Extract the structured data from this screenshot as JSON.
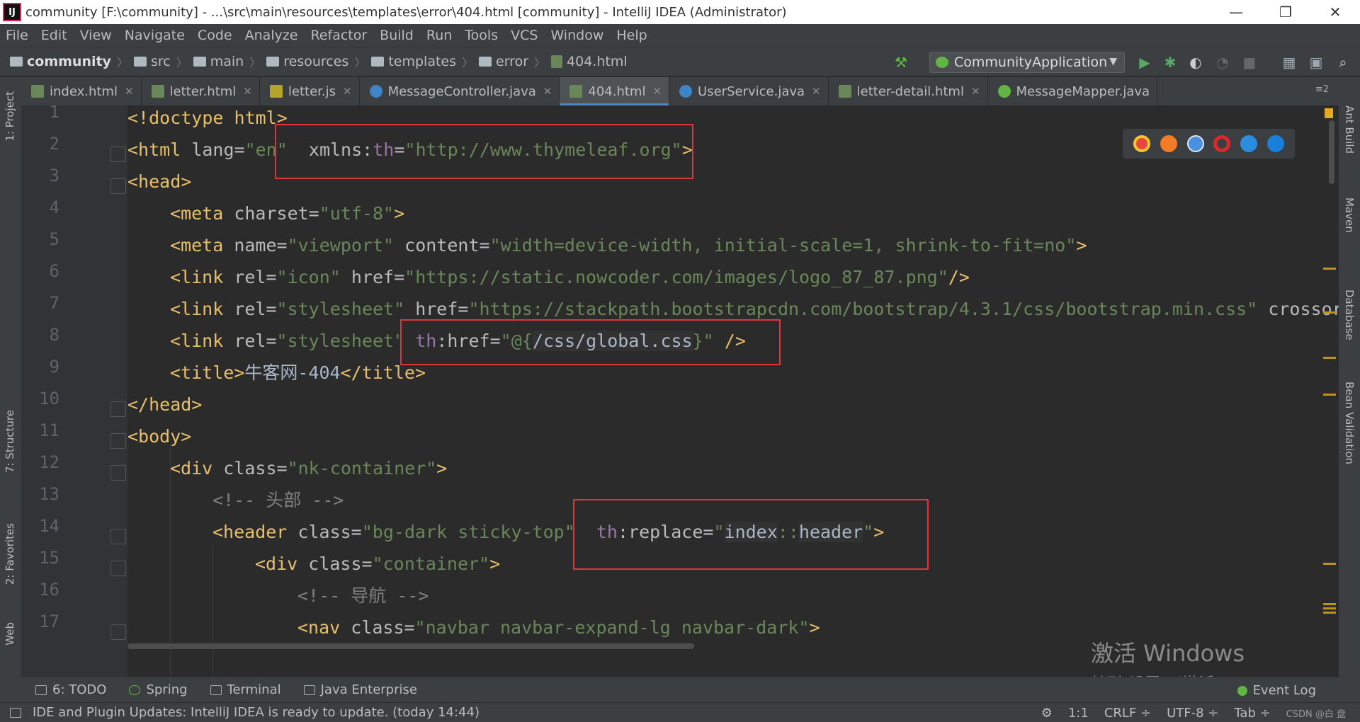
{
  "window": {
    "title": "community [F:\\community] - ...\\src\\main\\resources\\templates\\error\\404.html [community] - IntelliJ IDEA (Administrator)",
    "app_icon_text": "IJ",
    "controls": [
      "—",
      "❐",
      "✕"
    ]
  },
  "menu": [
    "File",
    "Edit",
    "View",
    "Navigate",
    "Code",
    "Analyze",
    "Refactor",
    "Build",
    "Run",
    "Tools",
    "VCS",
    "Window",
    "Help"
  ],
  "breadcrumb": [
    "community",
    "src",
    "main",
    "resources",
    "templates",
    "error",
    "404.html"
  ],
  "run_config": {
    "label": "CommunityApplication",
    "dropdown": "▼"
  },
  "tabs": [
    {
      "label": "index.html",
      "type": "html",
      "active": false
    },
    {
      "label": "letter.html",
      "type": "html",
      "active": false
    },
    {
      "label": "letter.js",
      "type": "js",
      "active": false
    },
    {
      "label": "MessageController.java",
      "type": "c",
      "active": false
    },
    {
      "label": "404.html",
      "type": "html",
      "active": true
    },
    {
      "label": "UserService.java",
      "type": "c",
      "active": false
    },
    {
      "label": "letter-detail.html",
      "type": "html",
      "active": false
    },
    {
      "label": "MessageMapper.java",
      "type": "i",
      "active": false
    }
  ],
  "tab_menu": "≡2",
  "left_tools": [
    "1: Project",
    "7: Structure",
    "2: Favorites",
    "Web"
  ],
  "right_tools": [
    "Ant Build",
    "Maven",
    "Database",
    "Bean Validation"
  ],
  "line_numbers": [
    "1",
    "2",
    "3",
    "4",
    "5",
    "6",
    "7",
    "8",
    "9",
    "10",
    "11",
    "12",
    "13",
    "14",
    "15",
    "16",
    "17"
  ],
  "code": {
    "l1": {
      "open": "<!doctype html>"
    },
    "l2": {
      "open": "<html ",
      "a1": "lang=",
      "v1": "\"en\"",
      "sp": "  ",
      "a2": "xmlns:",
      "ns": "th",
      "a3": "=",
      "v2": "\"http://www.thymeleaf.org\"",
      "close": ">"
    },
    "l3": {
      "open": "<head>"
    },
    "l4": {
      "open": "<meta ",
      "a1": "charset=",
      "v1": "\"utf-8\"",
      "close": ">"
    },
    "l5": {
      "open": "<meta ",
      "a1": "name=",
      "v1": "\"viewport\"",
      "a2": " content=",
      "v2": "\"width=device-width, initial-scale=1, shrink-to-fit=no\"",
      "close": ">"
    },
    "l6": {
      "open": "<link ",
      "a1": "rel=",
      "v1": "\"icon\"",
      "a2": " href=",
      "v2": "\"https://static.nowcoder.com/images/logo_87_87.png\"",
      "close": "/>"
    },
    "l7": {
      "open": "<link ",
      "a1": "rel=",
      "v1": "\"stylesheet\"",
      "a2": " href=",
      "v2": "\"https://stackpath.bootstrapcdn.com/bootstrap/4.3.1/css/bootstrap.min.css\"",
      "a3": " crossor"
    },
    "l8": {
      "open": "<link ",
      "a1": "rel=",
      "v1": "\"stylesheet\"",
      "sp": " ",
      "ns": "th",
      "a2": ":href=",
      "v2a": "\"",
      "expr_open": "@{",
      "v2b": "/",
      "expr_mid": "css",
      "v2c": "/",
      "expr_file": "global.css",
      "expr_close": "}",
      "v2d": "\"",
      "close": " />"
    },
    "l9": {
      "open": "<title>",
      "text": "牛客网-404",
      "close": "</title>"
    },
    "l10": {
      "open": "</head>"
    },
    "l11": {
      "open": "<body>"
    },
    "l12": {
      "open": "<div ",
      "a1": "class=",
      "v1": "\"nk-container\"",
      "close": ">"
    },
    "l13": {
      "comment": "<!-- 头部 -->"
    },
    "l14": {
      "open": "<header ",
      "a1": "class=",
      "v1": "\"bg-dark sticky-top\"",
      "sp": "  ",
      "ns": "th",
      "a2": ":replace=",
      "v2a": "\"",
      "expr1": "index",
      "sep": "::",
      "expr2": "header",
      "v2b": "\"",
      "close": ">"
    },
    "l15": {
      "open": "<div ",
      "a1": "class=",
      "v1": "\"container\"",
      "close": ">"
    },
    "l16": {
      "comment": "<!-- 导航 -->"
    },
    "l17": {
      "open": "<nav ",
      "a1": "class=",
      "v1": "\"navbar navbar-expand-lg navbar-dark\"",
      "close": ">"
    }
  },
  "browser_icons": [
    "chrome-icon",
    "firefox-icon",
    "safari-icon",
    "opera-icon",
    "ie-icon",
    "edge-icon"
  ],
  "colors": {
    "chrome": "#e8453c",
    "firefox": "#f27b26",
    "safari": "#4a90e2",
    "opera": "#e0252b",
    "ie": "#2a8de0",
    "edge": "#1a7fd8"
  },
  "watermark": {
    "line1": "激活 Windows",
    "line2": "转到\"设置\"以激活 Windows。"
  },
  "tool_windows": [
    {
      "label": "6: TODO"
    },
    {
      "label": "Spring"
    },
    {
      "label": "Terminal"
    },
    {
      "label": "Java Enterprise"
    }
  ],
  "event_log": "Event Log",
  "status": {
    "message": "IDE and Plugin Updates: IntelliJ IDEA is ready to update. (today 14:44)",
    "position": "1:1",
    "line_sep": "CRLF ÷",
    "encoding": "UTF-8 ÷",
    "indent": "Tab ÷",
    "corner_text": "CSDN @白 盘"
  }
}
